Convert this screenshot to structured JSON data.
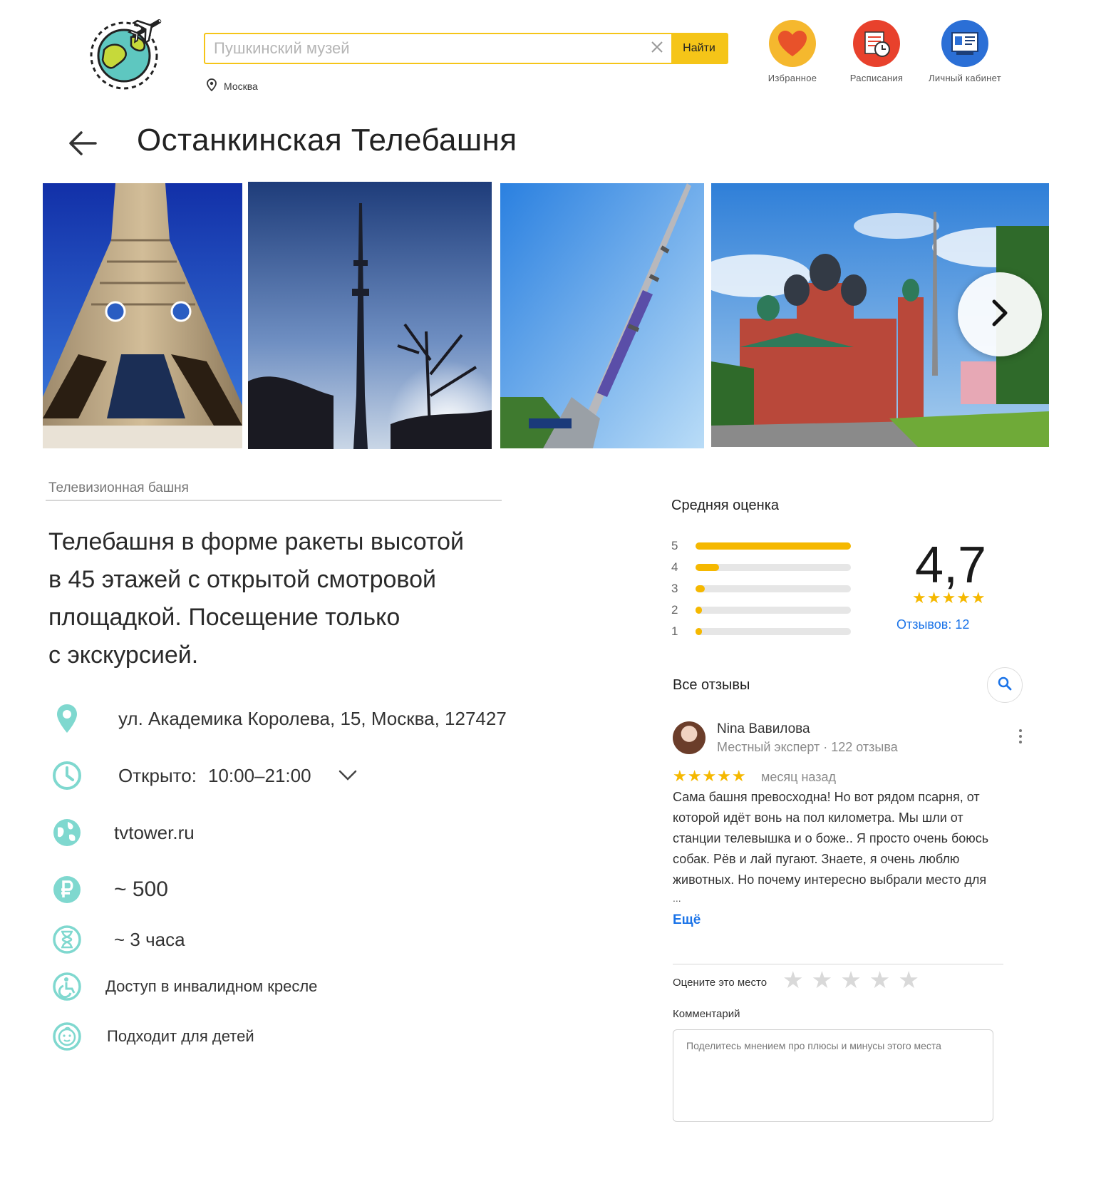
{
  "header": {
    "search": {
      "placeholder": "Пушкинский музей",
      "button_label": "Найти"
    },
    "location": "Москва",
    "nav": [
      {
        "label": "Избранное",
        "icon": "heart-icon",
        "color": "#f5b82e"
      },
      {
        "label": "Расписания",
        "icon": "schedule-icon",
        "color": "#e8412c"
      },
      {
        "label": "Личный кабинет",
        "icon": "account-icon",
        "color": "#2b6fd6"
      }
    ]
  },
  "page": {
    "title": "Останкинская Телебашня",
    "category": "Телевизионная башня",
    "description": [
      "Телебашня в форме ракеты высотой",
      "в 45 этажей с открытой смотровой",
      "площадкой. Посещение только",
      "с экскурсией."
    ]
  },
  "info": {
    "address": "ул. Академика Королева, 15, Москва, 127427",
    "hours_label": "Открыто:",
    "hours": "10:00–21:00",
    "website": "tvtower.ru",
    "price": "~ 500",
    "duration": "~ 3 часа",
    "wheelchair": "Доступ в инвалидном кресле",
    "kids": "Подходит для детей",
    "accent_color": "#7fd8cf"
  },
  "rating": {
    "title": "Средняя оценка",
    "average": "4,7",
    "stars": "★★★★★",
    "reviews_link": "Отзывов: 12",
    "bars": [
      {
        "label": "5",
        "fraction": 1.0
      },
      {
        "label": "4",
        "fraction": 0.15
      },
      {
        "label": "3",
        "fraction": 0.06
      },
      {
        "label": "2",
        "fraction": 0.02
      },
      {
        "label": "1",
        "fraction": 0.04
      }
    ],
    "bar_color": "#f5b800"
  },
  "reviews": {
    "title": "Все отзывы",
    "items": [
      {
        "author": "Nina Вавилова",
        "meta": "Местный эксперт  · 122 отзыва",
        "stars": "★★★★★",
        "time": "месяц назад",
        "lines": [
          "Сама башня превосходна! Но вот рядом псарня, от",
          "которой идёт вонь на пол километра. Мы шли от",
          "станции телевышка и о боже.. Я просто очень боюсь",
          "собак. Рёв  и лай пугают. Знаете, я очень люблю",
          "животных. Но почему интересно выбрали место для"
        ],
        "ellipsis": "...",
        "more": "Ещё"
      }
    ]
  },
  "rate_form": {
    "label": "Оцените это место",
    "comment_label": "Комментарий",
    "comment_placeholder": "Поделитесь мнением про плюсы и минусы этого места"
  }
}
